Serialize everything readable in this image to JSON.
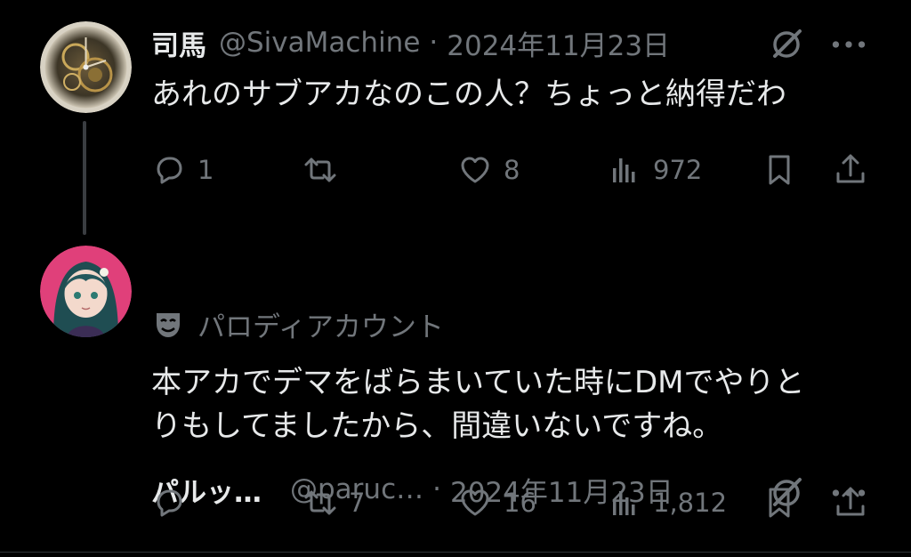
{
  "tweets": [
    {
      "author_name": "司馬",
      "handle": "@SivaMachine",
      "separator": "·",
      "date": "2024年11月23日",
      "text": "あれのサブアカなのこの人？ちょっと納得だわ",
      "replies": "1",
      "reposts": "",
      "likes": "8",
      "views": "972",
      "avatar": "clockwork-avatar"
    },
    {
      "author_name": "パルッ…",
      "handle": "@paruc…",
      "separator": "·",
      "date": "2024年11月23日",
      "parody_label": "パロディアカウント",
      "text_line1": "本アカでデマをばらまいていた時にDMでやりと",
      "text_line2": "りもしてましたから、間違いないですね。",
      "replies": "",
      "reposts": "7",
      "likes": "16",
      "views": "1,812",
      "avatar": "anime-girl-avatar"
    }
  ],
  "colors": {
    "background": "#000000",
    "text": "#e7e9ea",
    "muted": "#71767b",
    "thread_line": "#3a3d41"
  },
  "icons": [
    "grok-icon",
    "more-icon",
    "reply-icon",
    "repost-icon",
    "like-icon",
    "views-icon",
    "bookmark-icon",
    "share-icon",
    "parody-mask-icon"
  ]
}
